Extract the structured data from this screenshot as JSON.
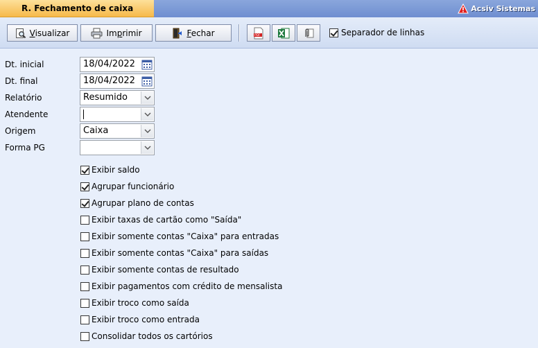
{
  "window": {
    "title": "R. Fechamento de caixa",
    "brand": "Acsiv Sistemas"
  },
  "toolbar": {
    "visualizar": {
      "underline": "V",
      "rest": "isualizar"
    },
    "imprimir": {
      "pre": "Im",
      "underline": "p",
      "rest": "rimir"
    },
    "fechar": {
      "underline": "F",
      "rest": "echar"
    },
    "separador_label": "Separador de linhas",
    "separador_checked": true
  },
  "form": {
    "dt_inicial": {
      "label": "Dt. inicial",
      "value": "18/04/2022"
    },
    "dt_final": {
      "label": "Dt. final",
      "value": "18/04/2022"
    },
    "relatorio": {
      "label": "Relatório",
      "value": "Resumido"
    },
    "atendente": {
      "label": "Atendente",
      "value": ""
    },
    "origem": {
      "label": "Origem",
      "value": "Caixa"
    },
    "forma_pg": {
      "label": "Forma PG",
      "value": ""
    }
  },
  "options": [
    {
      "label": "Exibir saldo",
      "checked": true
    },
    {
      "label": "Agrupar funcionário",
      "checked": true
    },
    {
      "label": "Agrupar plano de contas",
      "checked": true
    },
    {
      "label": "Exibir taxas de cartão como \"Saída\"",
      "checked": false
    },
    {
      "label": "Exibir somente contas \"Caixa\" para entradas",
      "checked": false
    },
    {
      "label": "Exibir somente contas \"Caixa\" para saídas",
      "checked": false
    },
    {
      "label": "Exibir somente contas de resultado",
      "checked": false
    },
    {
      "label": "Exibir pagamentos com crédito de mensalista",
      "checked": false
    },
    {
      "label": "Exibir troco como saída",
      "checked": false
    },
    {
      "label": "Exibir troco como entrada",
      "checked": false
    },
    {
      "label": "Consolidar todos os cartórios",
      "checked": false
    }
  ],
  "colors": {
    "tab": "#f6b94a",
    "titlebar": "#6e8ed0",
    "background": "#e8effb"
  }
}
